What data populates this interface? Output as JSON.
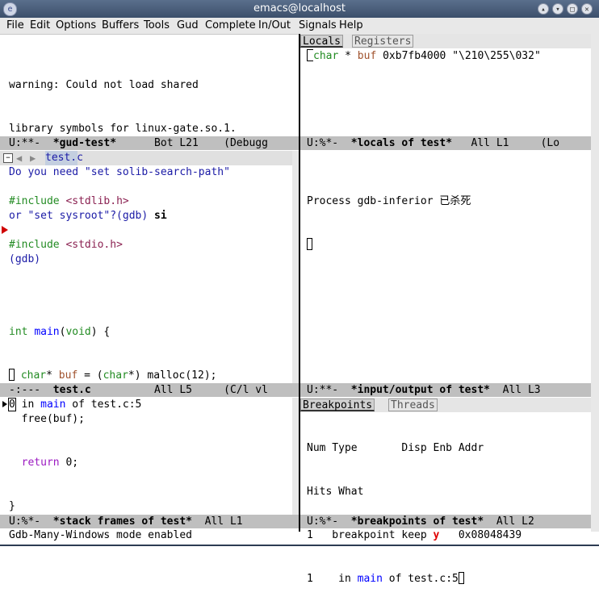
{
  "window": {
    "title": "emacs@localhost"
  },
  "menubar": [
    "File",
    "Edit",
    "Options",
    "Buffers",
    "Tools",
    "Gud",
    "Complete",
    "In/Out",
    "Signals",
    "Help"
  ],
  "gud": {
    "lines": [
      "warning: Could not load shared",
      "library symbols for linux-gate.so.1.",
      "Do you need \"set solib-search-path\"",
      "or \"set sysroot\"?(gdb) ",
      "(gdb)"
    ],
    "typed": "si",
    "modeline": {
      "status": "U:**-  ",
      "buffer": "*gud-test*",
      "pos": "      Bot L21    ",
      "mode": "(Debugg"
    }
  },
  "locals": {
    "tabs": {
      "locals": "Locals",
      "registers": "Registers"
    },
    "row": {
      "type": "char",
      "rest": " * ",
      "name": "buf",
      "value": " 0xb7fb4000 \"\\210\\255\\032\""
    },
    "modeline": {
      "status": "U:%*-  ",
      "buffer": "*locals of test*",
      "pos": "   All L1     ",
      "mode": "(Lo"
    }
  },
  "source": {
    "toolbar_file": "test.c",
    "lines": {
      "l1_pp": "#include",
      "l1_h": " <stdlib.h>",
      "l2_pp": "#include",
      "l2_h": " <stdio.h>",
      "l4_type": "int",
      "l4_fn": "main",
      "l4_void": "void",
      "l4_rest": ") {",
      "l5_type": "char",
      "l5_star": "* ",
      "l5_var": "buf",
      "l5_mid": " = (",
      "l5_type2": "char",
      "l5_end": "*) malloc(12);",
      "l6": "  free(buf);",
      "l7_kw": "return",
      "l7_rest": " 0;",
      "l8": "}"
    },
    "modeline": {
      "status": "-:---  ",
      "buffer": "test.c",
      "pos": "          All L5     ",
      "mode": "(C/l vl"
    }
  },
  "io": {
    "line": "Process gdb-inferior 已杀死",
    "modeline": {
      "status": "U:**-  ",
      "buffer": "*input/output of test*",
      "pos": "  All L3"
    }
  },
  "stack": {
    "frame_num": "0",
    "in": " in ",
    "fn": "main",
    "rest": " of test.c:5",
    "modeline": {
      "status": "U:%*-  ",
      "buffer": "*stack frames of test*",
      "pos": "  All L1"
    }
  },
  "breakpoints": {
    "tabs": {
      "breakpoints": "Breakpoints",
      "threads": "Threads"
    },
    "header1": "Num Type       Disp Enb Addr",
    "header2": "Hits What",
    "row1_pre": "1   breakpoint keep ",
    "row1_enb": "y",
    "row1_addr": "   0x08048439",
    "row2_pre": "1    in ",
    "row2_fn": "main",
    "row2_rest": " of test.c:5",
    "modeline": {
      "status": "U:%*-  ",
      "buffer": "*breakpoints of test*",
      "pos": "  All L2"
    }
  },
  "echo_area": "Gdb-Many-Windows mode enabled"
}
